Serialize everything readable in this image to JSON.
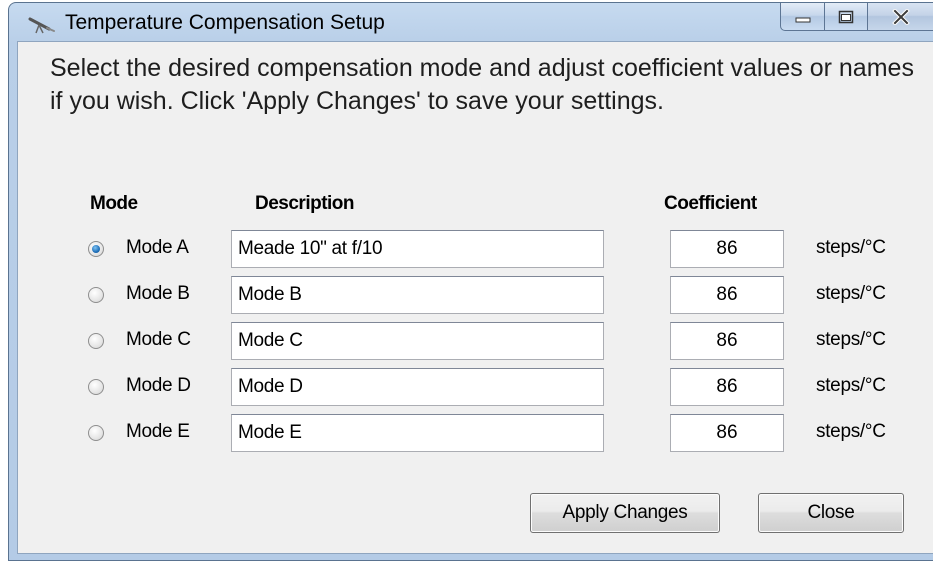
{
  "window": {
    "title": "Temperature Compensation Setup",
    "icon": "telescope-icon"
  },
  "caption_buttons": {
    "minimize": "minimize-icon",
    "maximize": "maximize-icon",
    "close": "close-icon"
  },
  "instructions": "Select the desired compensation mode and adjust coefficient values or names if you wish. Click 'Apply Changes' to save your settings.",
  "headers": {
    "mode": "Mode",
    "description": "Description",
    "coefficient": "Coefficient"
  },
  "rows": [
    {
      "mode": "Mode A",
      "selected": true,
      "description": "Meade 10\" at f/10",
      "coefficient": "86",
      "unit": "steps/°C"
    },
    {
      "mode": "Mode B",
      "selected": false,
      "description": "Mode B",
      "coefficient": "86",
      "unit": "steps/°C"
    },
    {
      "mode": "Mode C",
      "selected": false,
      "description": "Mode C",
      "coefficient": "86",
      "unit": "steps/°C"
    },
    {
      "mode": "Mode D",
      "selected": false,
      "description": "Mode D",
      "coefficient": "86",
      "unit": "steps/°C"
    },
    {
      "mode": "Mode E",
      "selected": false,
      "description": "Mode E",
      "coefficient": "86",
      "unit": "steps/°C"
    }
  ],
  "buttons": {
    "apply": "Apply Changes",
    "close": "Close"
  },
  "colors": {
    "title_bar": "#b9cfe8",
    "client_background": "#f0f0f0",
    "radio_selected": "#1f6fb8"
  }
}
